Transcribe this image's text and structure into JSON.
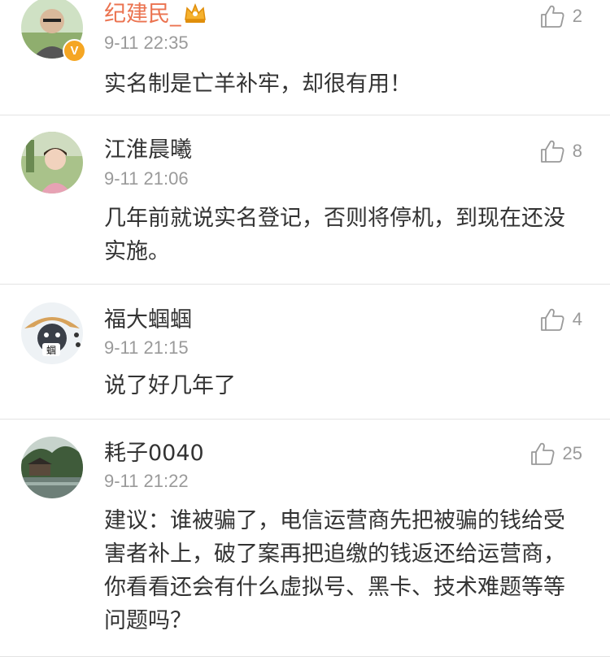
{
  "comments": [
    {
      "username": "纪建民_",
      "timestamp": "9-11 22:35",
      "content": "实名制是亡羊补牢，却很有用！",
      "likes": "2",
      "verified": true,
      "verified_badge": "V",
      "username_color": "#eb7350",
      "vip_icon": "crown-icon"
    },
    {
      "username": "江淮晨曦",
      "timestamp": "9-11 21:06",
      "content": "几年前就说实名登记，否则将停机，到现在还没实施。",
      "likes": "8"
    },
    {
      "username": "福大蝈蝈",
      "timestamp": "9-11 21:15",
      "content": "说了好几年了",
      "likes": "4",
      "avatar_text": "蝈"
    },
    {
      "username": "耗子0040",
      "timestamp": "9-11 21:22",
      "content": "建议：谁被骗了，电信运营商先把被骗的钱给受害者补上，破了案再把追缴的钱返还给运营商，你看看还会有什么虚拟号、黑卡、技术难题等等问题吗？",
      "likes": "25"
    }
  ],
  "colors": {
    "username": "#333333",
    "vip_username": "#eb7350",
    "meta": "#9a9a9a",
    "divider": "#e3e3e3",
    "verified": "#f5a623"
  },
  "icons": {
    "like": "thumbs-up-icon",
    "verified": "verified-badge-icon"
  }
}
